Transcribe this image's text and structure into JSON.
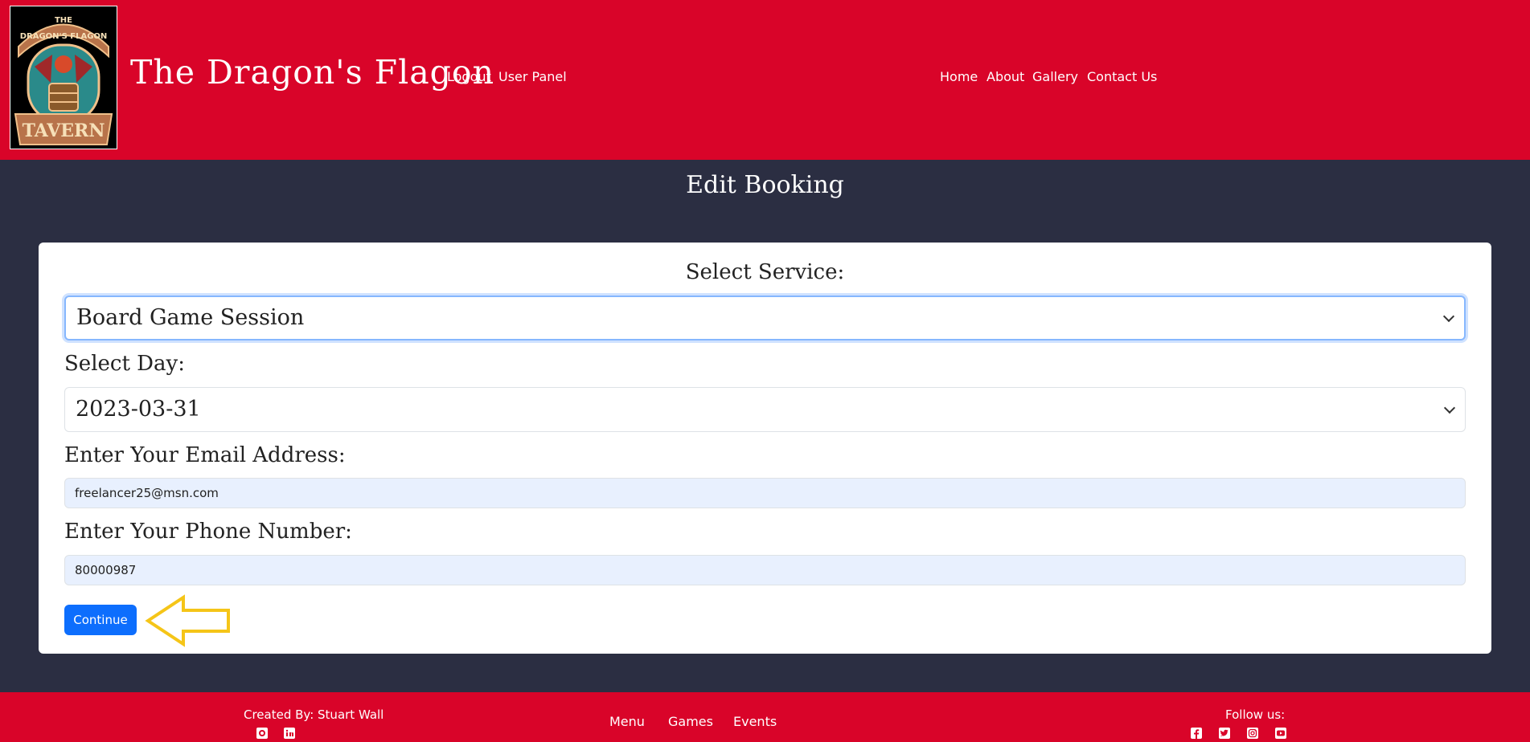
{
  "header": {
    "site_title": "The Dragon's Flagon",
    "logo_text_top": "THE",
    "logo_text_mid": "DRAGON'S FLAGON",
    "logo_text_bottom": "TAVERN",
    "user_nav": [
      "Logout",
      "User Panel"
    ],
    "main_nav": [
      "Home",
      "About",
      "Gallery",
      "Contact Us"
    ]
  },
  "main": {
    "page_title": "Edit Booking",
    "form": {
      "service_label": "Select Service:",
      "service_value": "Board Game Session",
      "day_label": "Select Day:",
      "day_value": "2023-03-31",
      "email_label": "Enter Your Email Address:",
      "email_value": "freelancer25@msn.com",
      "phone_label": "Enter Your Phone Number:",
      "phone_value": "80000987",
      "continue_label": "Continue"
    }
  },
  "footer": {
    "created_by": "Created By: Stuart Wall",
    "links": [
      "Menu",
      "Games",
      "Events"
    ],
    "follow_label": "Follow us:",
    "creator_icons": [
      "github-icon",
      "linkedin-icon"
    ],
    "social_icons": [
      "facebook-icon",
      "twitter-icon",
      "instagram-icon",
      "youtube-icon"
    ]
  },
  "colors": {
    "brand_red": "#d90429",
    "background": "#2b2e42",
    "primary_button": "#0d6efd",
    "annotation_arrow": "#f5c518"
  }
}
